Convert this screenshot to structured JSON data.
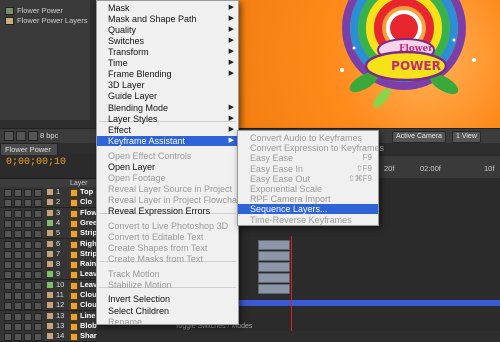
{
  "project": {
    "items": [
      "Flower Power",
      "Flower Power Layers"
    ]
  },
  "left_toolbar": {
    "bpc": "8 bpc"
  },
  "viewer": {
    "art_title_top": "Flower",
    "art_title_bottom": "POWER",
    "colors": {
      "background": "#ff8a18"
    }
  },
  "viewer_toolbar": {
    "camera": "Active Camera",
    "view": "1 View"
  },
  "timeline": {
    "tab": "Flower Power",
    "timecode": "0;00;00;10",
    "column_header": "Layer Name",
    "layers": [
      {
        "num": "1",
        "name": "Top",
        "color": "#c8a27a"
      },
      {
        "num": "2",
        "name": "Clo",
        "color": "#c8a27a"
      },
      {
        "num": "3",
        "name": "Flow",
        "color": "#c8a27a"
      },
      {
        "num": "4",
        "name": "Gree",
        "color": "#7dbf6a"
      },
      {
        "num": "5",
        "name": "Strip",
        "color": "#c8a27a"
      },
      {
        "num": "6",
        "name": "Righ",
        "color": "#c8a27a"
      },
      {
        "num": "7",
        "name": "Strip",
        "color": "#c8a27a"
      },
      {
        "num": "8",
        "name": "Rain",
        "color": "#c8a27a"
      },
      {
        "num": "9",
        "name": "Leav",
        "color": "#7dbf6a"
      },
      {
        "num": "10",
        "name": "Leav",
        "color": "#7dbf6a"
      },
      {
        "num": "11",
        "name": "Clou",
        "color": "#c8a27a"
      },
      {
        "num": "12",
        "name": "Clou",
        "color": "#c8a27a"
      },
      {
        "num": "13",
        "name": "Line",
        "color": "#c8a27a"
      },
      {
        "num": "13",
        "name": "Blob",
        "color": "#c8a27a"
      },
      {
        "num": "14",
        "name": "Shar",
        "color": "#c8a27a"
      }
    ],
    "ruler_labels": [
      "20f",
      "02:00f",
      "10f"
    ],
    "toggle_label": "Toggle Switches / Modes"
  },
  "menu": {
    "items": [
      {
        "label": "Mask",
        "arrow": true
      },
      {
        "label": "Mask and Shape Path",
        "arrow": true
      },
      {
        "label": "Quality",
        "arrow": true
      },
      {
        "label": "Switches",
        "arrow": true
      },
      {
        "label": "Transform",
        "arrow": true
      },
      {
        "label": "Time",
        "arrow": true
      },
      {
        "label": "Frame Blending",
        "arrow": true
      },
      {
        "label": "3D Layer",
        "arrow": false
      },
      {
        "label": "Guide Layer",
        "arrow": false
      },
      {
        "label": "Blending Mode",
        "arrow": true
      },
      {
        "label": "Layer Styles",
        "arrow": true
      },
      {
        "label": "Effect",
        "arrow": true
      },
      {
        "label": "Keyframe Assistant",
        "arrow": true
      },
      {
        "label": "Open Effect Controls",
        "arrow": false
      },
      {
        "label": "Open Layer",
        "arrow": false
      },
      {
        "label": "Open Footage",
        "arrow": false
      },
      {
        "label": "Reveal Layer Source in Project",
        "arrow": false
      },
      {
        "label": "Reveal Layer in Project Flowchart",
        "arrow": false
      },
      {
        "label": "Reveal Expression Errors",
        "arrow": false
      },
      {
        "label": "Convert to Live Photoshop 3D",
        "arrow": false
      },
      {
        "label": "Convert to Editable Text",
        "arrow": false
      },
      {
        "label": "Create Shapes from Text",
        "arrow": false
      },
      {
        "label": "Create Masks from Text",
        "arrow": false
      },
      {
        "label": "Track Motion",
        "arrow": false
      },
      {
        "label": "Stabilize Motion",
        "arrow": false
      },
      {
        "label": "Invert Selection",
        "arrow": false
      },
      {
        "label": "Select Children",
        "arrow": false
      },
      {
        "label": "Rename",
        "arrow": false
      }
    ]
  },
  "submenu": {
    "items": [
      {
        "label": "Convert Audio to Keyframes",
        "shortcut": ""
      },
      {
        "label": "Convert Expression to Keyframes",
        "shortcut": ""
      },
      {
        "label": "Easy Ease",
        "shortcut": "F9"
      },
      {
        "label": "Easy Ease In",
        "shortcut": "⇧F9"
      },
      {
        "label": "Easy Ease Out",
        "shortcut": "⇧⌘F9"
      },
      {
        "label": "Exponential Scale",
        "shortcut": ""
      },
      {
        "label": "RPF Camera Import",
        "shortcut": ""
      },
      {
        "label": "Sequence Layers...",
        "shortcut": ""
      },
      {
        "label": "Time-Reverse Keyframes",
        "shortcut": ""
      }
    ]
  }
}
